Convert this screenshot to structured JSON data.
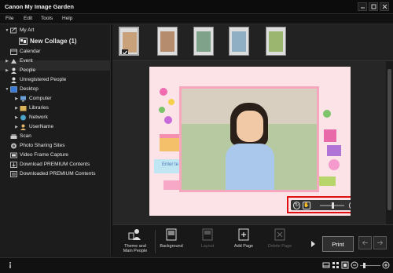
{
  "window": {
    "title": "Canon My Image Garden"
  },
  "menu": [
    "File",
    "Edit",
    "Tools",
    "Help"
  ],
  "sidebar": {
    "items": [
      {
        "label": "My Art"
      },
      {
        "label": "New Collage (1)"
      },
      {
        "label": "Calendar"
      },
      {
        "label": "Event"
      },
      {
        "label": "People"
      },
      {
        "label": "Unregistered People"
      },
      {
        "label": "Desktop"
      },
      {
        "label": "Computer"
      },
      {
        "label": "Libraries"
      },
      {
        "label": "Network"
      },
      {
        "label": "UserName"
      },
      {
        "label": "Scan"
      },
      {
        "label": "Photo Sharing Sites"
      },
      {
        "label": "Video Frame Capture"
      },
      {
        "label": "Download PREMIUM Contents"
      },
      {
        "label": "Downloaded PREMIUM Contents"
      }
    ]
  },
  "canvas": {
    "text_label": "Enter te"
  },
  "toolbar": {
    "theme_label_1": "Theme and",
    "theme_label_2": "Main People",
    "background_label": "Background",
    "layout_label": "Layout",
    "add_page_label": "Add Page",
    "delete_page_label": "Delete Page",
    "print_label": "Print"
  },
  "colors": {
    "accent_red": "#e01010",
    "canvas_bg": "#fbe3e7"
  }
}
